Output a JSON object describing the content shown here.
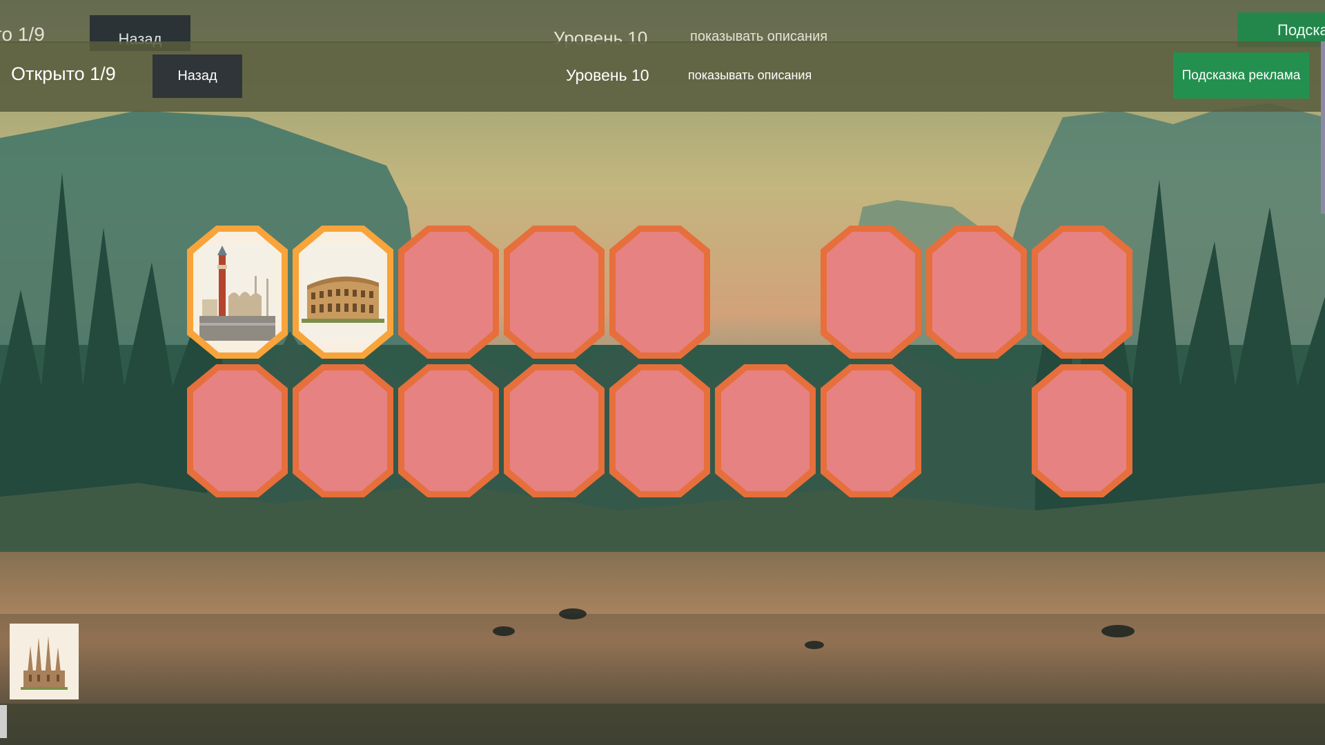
{
  "ghost_header": {
    "counter": "то 1/9",
    "back_label": "Назад",
    "level": "Уровень 10",
    "descriptions": "показывать описания",
    "hint": "Подска"
  },
  "header": {
    "counter": "Открыто 1/9",
    "back_label": "Назад",
    "level": "Уровень 10",
    "descriptions_toggle": "показывать описания",
    "hint_label": "Подсказка реклама"
  },
  "board": {
    "rows": [
      [
        "venice",
        "colosseum",
        "hidden",
        "hidden",
        "hidden",
        "empty",
        "hidden",
        "hidden",
        "hidden"
      ],
      [
        "hidden",
        "hidden",
        "hidden",
        "hidden",
        "hidden",
        "hidden",
        "hidden",
        "empty",
        "hidden"
      ]
    ]
  },
  "icons": {
    "venice": "venice-campanile-icon",
    "colosseum": "colosseum-icon",
    "tray": "sagrada-familia-icon"
  },
  "colors": {
    "card_border": "#e66f3c",
    "card_face": "#e68282",
    "open_border": "#f8a43a",
    "hint_green": "#24904f",
    "back_button": "#2f3538"
  }
}
